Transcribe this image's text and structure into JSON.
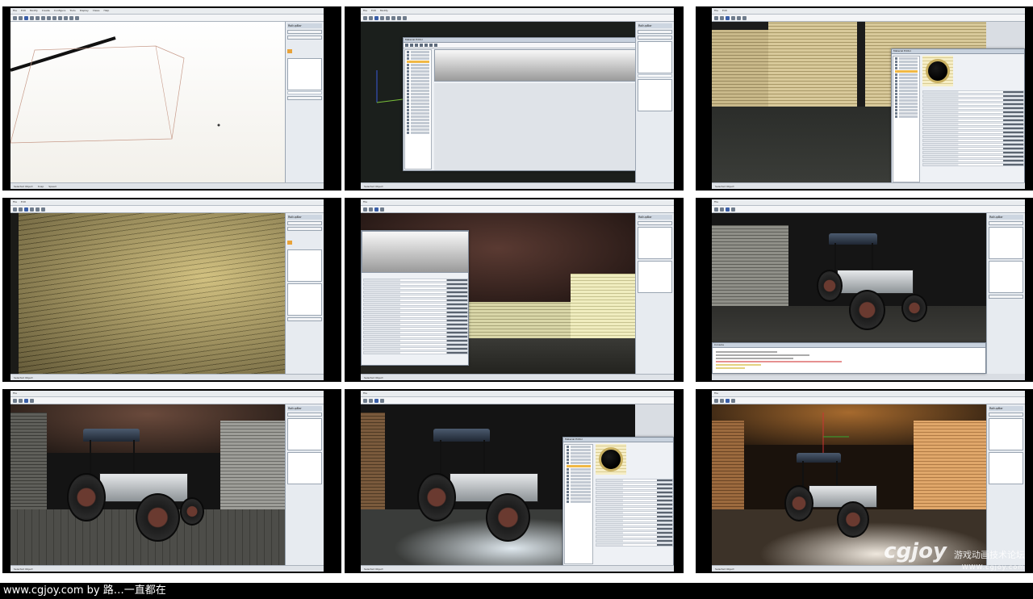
{
  "editor": {
    "menu": [
      "File",
      "Edit",
      "Modify",
      "Create",
      "Configure",
      "Tools",
      "Display",
      "Views",
      "Help"
    ],
    "right_panel_title": "RollupBar",
    "status_items": [
      "Selected Object",
      "Lock Selection",
      "Snap",
      "Speed",
      "Terrain Collision",
      "AI/Physics",
      "Go to Position"
    ]
  },
  "tiles": [
    {
      "id": "1",
      "scene": "white-box-grid"
    },
    {
      "id": "2",
      "scene": "material-editor-empty"
    },
    {
      "id": "3",
      "scene": "brick-room-material-editor"
    },
    {
      "id": "4",
      "scene": "brick-wall-closeup"
    },
    {
      "id": "5",
      "scene": "room-with-properties"
    },
    {
      "id": "6",
      "scene": "tractor-console"
    },
    {
      "id": "7",
      "scene": "tractor-lights"
    },
    {
      "id": "8",
      "scene": "tractor-material"
    },
    {
      "id": "9",
      "scene": "tractor-warm-light"
    }
  ],
  "dialog": {
    "material_editor_title": "Material Editor",
    "console_title": "Console"
  },
  "caption": {
    "text": "www.cgjoy.com by 路…一直都在"
  },
  "watermark": {
    "logo": "cgjoy",
    "cn": "游戏动画技术论坛",
    "url": "WWW.cgjoy.com"
  },
  "colors": {
    "background": "#000000",
    "sheet": "#ffffff",
    "selection": "#f0b845"
  }
}
